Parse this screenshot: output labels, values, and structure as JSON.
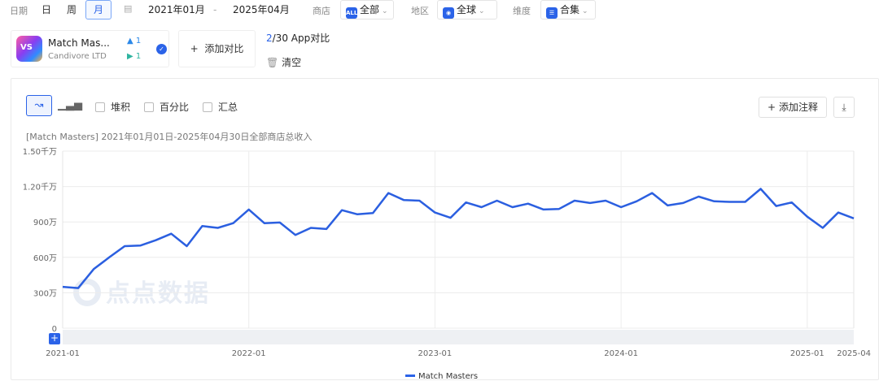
{
  "filters": {
    "date_label": "日期",
    "granularity": [
      "日",
      "周",
      "月"
    ],
    "active_granularity": "月",
    "start_date": "2021年01月",
    "date_separator": "-",
    "end_date": "2025年04月",
    "store_label": "商店",
    "store_icon_text": "ALL",
    "store_value": "全部",
    "region_label": "地区",
    "region_value": "全球",
    "dimension_label": "维度",
    "dimension_value": "合集"
  },
  "app": {
    "icon_text": "VS",
    "name": "Match Mas...",
    "developer": "Candivore LTD",
    "appstore_count": "1",
    "googleplay_count": "1"
  },
  "compare": {
    "add_label": "添加对比",
    "count_num": "2",
    "count_rest": "/30 App对比",
    "clear_label": "清空"
  },
  "toolbar": {
    "stack_label": "堆积",
    "percent_label": "百分比",
    "summary_label": "汇总",
    "annotate_label": "添加注释"
  },
  "watermark": "点点数据",
  "colors": {
    "accent": "#2b63e8",
    "line": "#2b5fe0"
  },
  "chart_data": {
    "type": "line",
    "title": "[Match Masters] 2021年01月01日-2025年04月30日全部商店总收入",
    "x": [
      "2021-01",
      "2021-02",
      "2021-03",
      "2021-04",
      "2021-05",
      "2021-06",
      "2021-07",
      "2021-08",
      "2021-09",
      "2021-10",
      "2021-11",
      "2021-12",
      "2022-01",
      "2022-02",
      "2022-03",
      "2022-04",
      "2022-05",
      "2022-06",
      "2022-07",
      "2022-08",
      "2022-09",
      "2022-10",
      "2022-11",
      "2022-12",
      "2023-01",
      "2023-02",
      "2023-03",
      "2023-04",
      "2023-05",
      "2023-06",
      "2023-07",
      "2023-08",
      "2023-09",
      "2023-10",
      "2023-11",
      "2023-12",
      "2024-01",
      "2024-02",
      "2024-03",
      "2024-04",
      "2024-05",
      "2024-06",
      "2024-07",
      "2024-08",
      "2024-09",
      "2024-10",
      "2024-11",
      "2024-12",
      "2025-01",
      "2025-02",
      "2025-03",
      "2025-04"
    ],
    "series": [
      {
        "name": "Match Masters",
        "values": [
          3500000,
          3400000,
          5000000,
          6000000,
          6950000,
          7000000,
          7450000,
          8000000,
          6950000,
          8650000,
          8500000,
          8900000,
          10050000,
          8900000,
          8950000,
          7900000,
          8500000,
          8400000,
          10000000,
          9650000,
          9750000,
          11450000,
          10850000,
          10800000,
          9800000,
          9350000,
          10650000,
          10250000,
          10800000,
          10250000,
          10550000,
          10050000,
          10100000,
          10800000,
          10600000,
          10800000,
          10250000,
          10750000,
          11450000,
          10400000,
          10600000,
          11150000,
          10750000,
          10700000,
          10700000,
          11800000,
          10350000,
          10650000,
          9450000,
          8500000,
          9800000,
          9300000
        ]
      }
    ],
    "y_ticks": [
      "0",
      "300万",
      "600万",
      "900万",
      "1.20千万",
      "1.50千万"
    ],
    "ylim": [
      0,
      15000000
    ],
    "x_tick_labels": [
      "2021-01",
      "2022-01",
      "2023-01",
      "2024-01",
      "2025-01",
      "2025-04"
    ],
    "grid": true,
    "legend": "bottom"
  }
}
